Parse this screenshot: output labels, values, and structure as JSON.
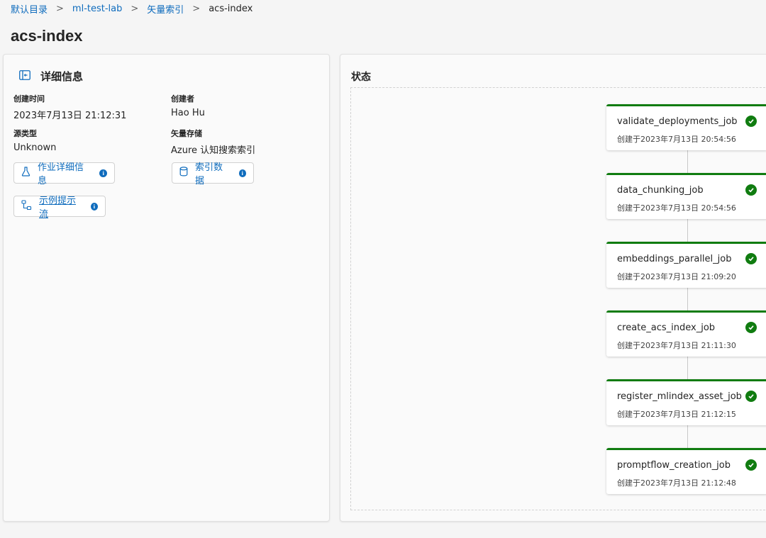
{
  "breadcrumb": {
    "items": [
      "默认目录",
      "ml-test-lab",
      "矢量索引"
    ],
    "current": "acs-index"
  },
  "page": {
    "title": "acs-index"
  },
  "details": {
    "title": "详细信息",
    "fields": {
      "created_time": {
        "label": "创建时间",
        "value": "2023年7月13日 21:12:31"
      },
      "creator": {
        "label": "创建者",
        "value": "Hao Hu"
      },
      "source_type": {
        "label": "源类型",
        "value": "Unknown"
      },
      "vector_store": {
        "label": "矢量存储",
        "value": "Azure 认知搜索索引"
      }
    },
    "buttons": {
      "job_details": "作业详细信息",
      "index_data": "索引数据",
      "sample_flow": "示例提示流"
    }
  },
  "status": {
    "title": "状态",
    "jobs": [
      {
        "name": "validate_deployments_job",
        "created": "创建于2023年7月13日 20:54:56"
      },
      {
        "name": "data_chunking_job",
        "created": "创建于2023年7月13日 20:54:56"
      },
      {
        "name": "embeddings_parallel_job",
        "created": "创建于2023年7月13日 21:09:20"
      },
      {
        "name": "create_acs_index_job",
        "created": "创建于2023年7月13日 21:11:30"
      },
      {
        "name": "register_mlindex_asset_job",
        "created": "创建于2023年7月13日 21:12:15"
      },
      {
        "name": "promptflow_creation_job",
        "created": "创建于2023年7月13日 21:12:48"
      }
    ]
  },
  "colors": {
    "accent": "#0f6cbd",
    "success": "#107c10"
  },
  "icons": [
    "details-panel-icon",
    "flask-icon",
    "database-icon",
    "flow-icon",
    "info-icon",
    "chevron-right-icon",
    "check-circle-icon"
  ]
}
